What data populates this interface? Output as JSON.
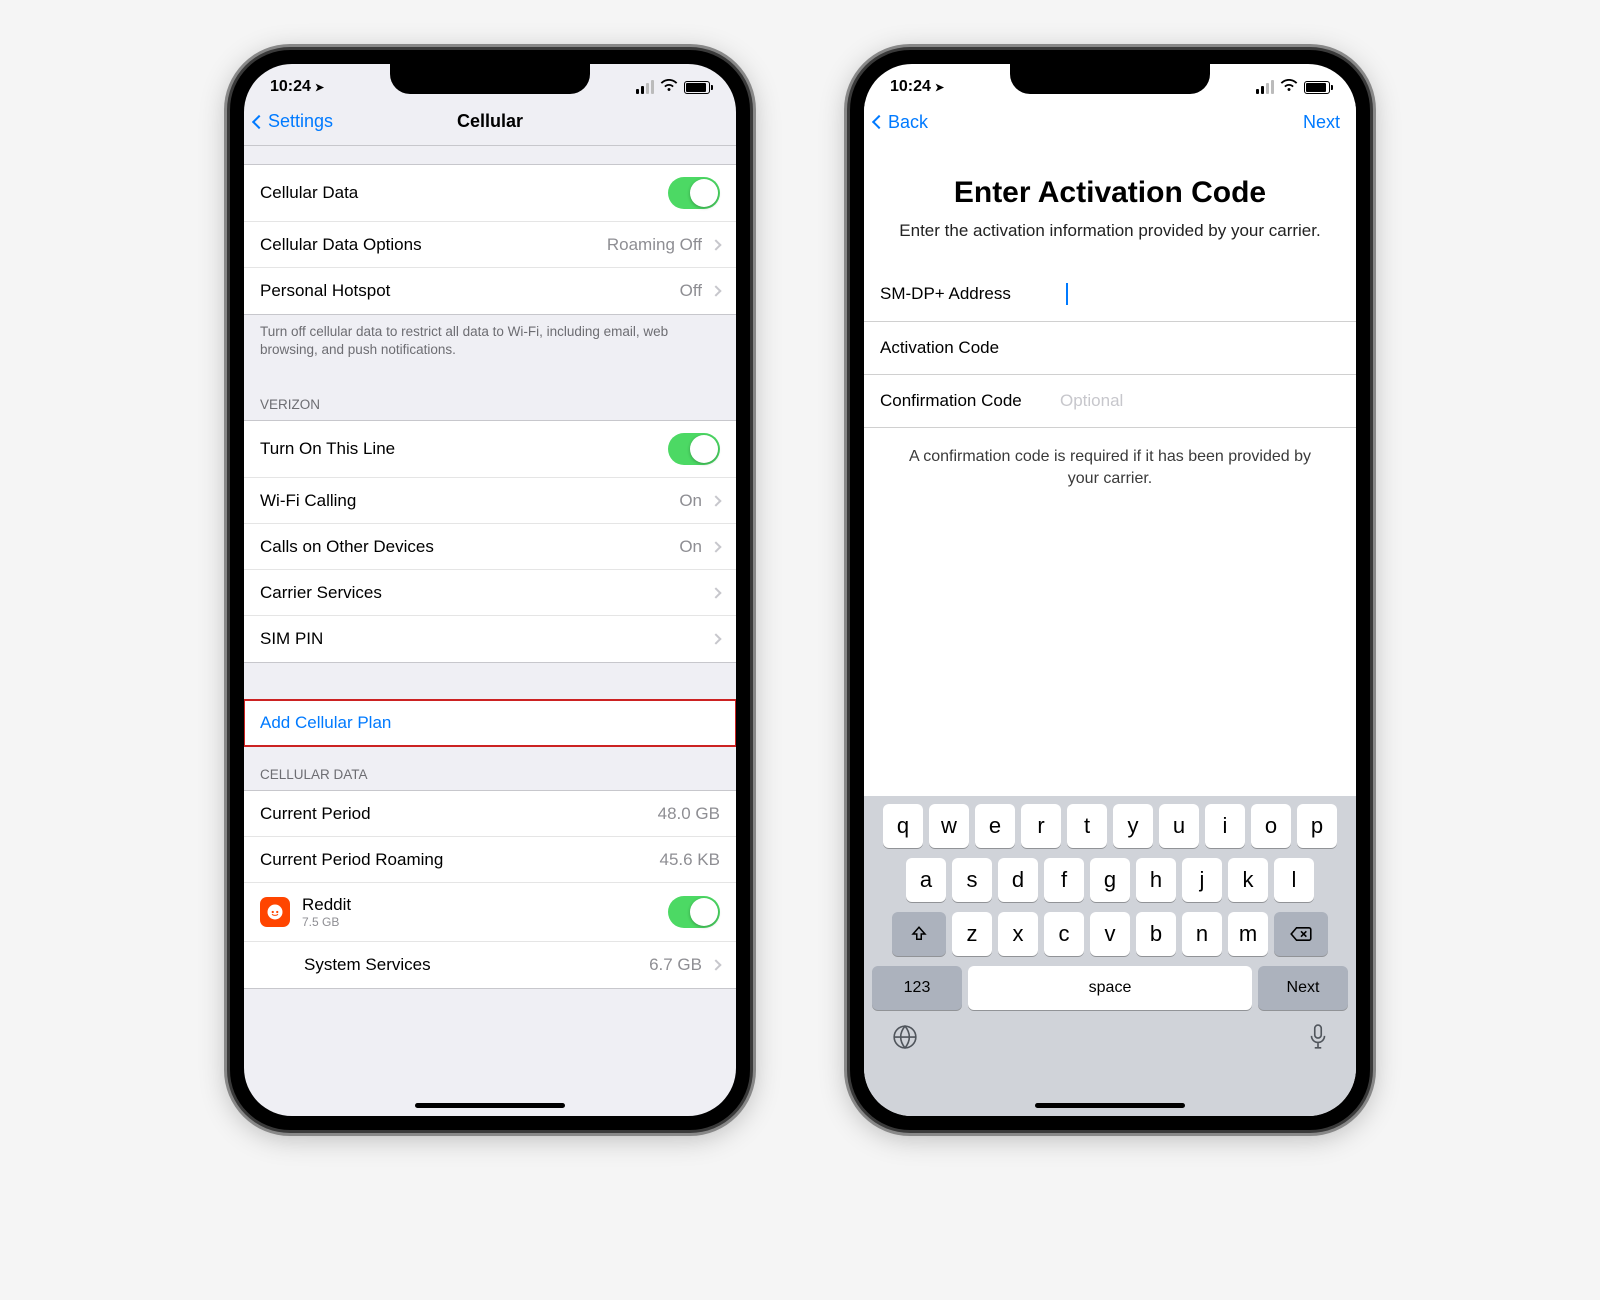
{
  "colors": {
    "accent": "#007aff",
    "toggle_on": "#4cd964",
    "highlight_border": "#c22222"
  },
  "status": {
    "time": "10:24",
    "location_icon": "➤"
  },
  "left_screen": {
    "nav": {
      "back": "Settings",
      "title": "Cellular"
    },
    "group1": {
      "cellular_data": "Cellular Data",
      "cellular_data_options": {
        "label": "Cellular Data Options",
        "value": "Roaming Off"
      },
      "personal_hotspot": {
        "label": "Personal Hotspot",
        "value": "Off"
      },
      "footer": "Turn off cellular data to restrict all data to Wi-Fi, including email, web browsing, and push notifications."
    },
    "carrier": {
      "header": "VERIZON",
      "turn_on_line": "Turn On This Line",
      "wifi_calling": {
        "label": "Wi-Fi Calling",
        "value": "On"
      },
      "calls_other": {
        "label": "Calls on Other Devices",
        "value": "On"
      },
      "carrier_services": "Carrier Services",
      "sim_pin": "SIM PIN"
    },
    "add_plan": "Add Cellular Plan",
    "data": {
      "header": "CELLULAR DATA",
      "current_period": {
        "label": "Current Period",
        "value": "48.0 GB"
      },
      "current_period_roaming": {
        "label": "Current Period Roaming",
        "value": "45.6 KB"
      },
      "app_reddit": {
        "name": "Reddit",
        "size": "7.5 GB"
      },
      "system_services": {
        "label": "System Services",
        "value": "6.7 GB"
      }
    }
  },
  "right_screen": {
    "nav": {
      "back": "Back",
      "next": "Next"
    },
    "title": "Enter Activation Code",
    "subtitle": "Enter the activation information provided by your carrier.",
    "fields": {
      "smdp": "SM-DP+ Address",
      "activation": "Activation Code",
      "confirmation": "Confirmation Code",
      "confirmation_placeholder": "Optional"
    },
    "footer": "A confirmation code is required if it has been provided by your carrier.",
    "keyboard": {
      "row1": [
        "q",
        "w",
        "e",
        "r",
        "t",
        "y",
        "u",
        "i",
        "o",
        "p"
      ],
      "row2": [
        "a",
        "s",
        "d",
        "f",
        "g",
        "h",
        "j",
        "k",
        "l"
      ],
      "row3": [
        "z",
        "x",
        "c",
        "v",
        "b",
        "n",
        "m"
      ],
      "num_key": "123",
      "space": "space",
      "next": "Next"
    }
  }
}
